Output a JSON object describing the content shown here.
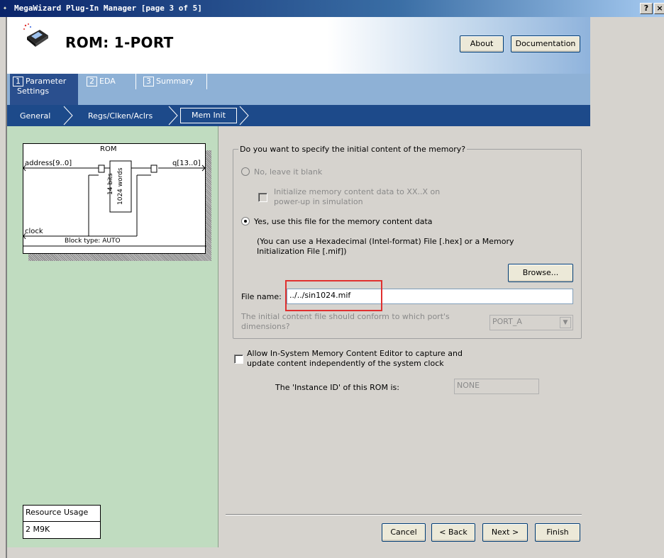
{
  "window": {
    "title": "MegaWizard Plug-In Manager [page 3 of 5]",
    "help_button": "?",
    "close_button": "×"
  },
  "header": {
    "title": "ROM: 1-PORT",
    "about_label": "About",
    "documentation_label": "Documentation"
  },
  "tabs": [
    {
      "num": "1",
      "label": "Parameter Settings",
      "label_line1": "Parameter",
      "label_line2": "Settings",
      "active": true
    },
    {
      "num": "2",
      "label": "EDA",
      "active": false
    },
    {
      "num": "3",
      "label": "Summary",
      "active": false
    }
  ],
  "breadcrumbs": [
    "General",
    "Regs/Clken/Aclrs",
    "Mem Init"
  ],
  "diagram": {
    "title": "ROM",
    "input_address": "address[9..0]",
    "output_q": "q[13..0]",
    "input_clock": "clock",
    "mem_bits": "14 bits",
    "mem_words": "1024 words",
    "block_type": "Block type: AUTO"
  },
  "resource": {
    "header": "Resource Usage",
    "value": "2 M9K"
  },
  "mem_init": {
    "question": "Do you want to specify the initial content of the memory?",
    "option_blank": "No, leave it blank",
    "init_xx_line1": "Initialize memory content data to XX..X on",
    "init_xx_line2": "power-up in simulation",
    "option_file": "Yes, use this file for the memory content data",
    "hint_line1": "(You can use a Hexadecimal (Intel-format) File [.hex] or a Memory",
    "hint_line2": "Initialization File [.mif])",
    "browse_label": "Browse...",
    "file_name_label": "File name:",
    "file_name_value": "../../sin1024.mif",
    "port_question_line1": "The initial content file should conform to which port's",
    "port_question_line2": "dimensions?",
    "port_value": "PORT_A",
    "selected_option": "file"
  },
  "insystem": {
    "label_line1": "Allow In-System Memory Content Editor to capture and",
    "label_line2": "update content independently of the system clock",
    "instance_id_label": "The 'Instance ID' of this ROM is:",
    "instance_id_value": "NONE",
    "checked": false
  },
  "footer": {
    "cancel_label": "Cancel",
    "back_label": "< Back",
    "next_label": "Next >",
    "finish_label": "Finish"
  },
  "colors": {
    "titlebar_dark": "#0a246a",
    "tab_band": "#8eb1d6",
    "crumb_band": "#1d4a8a",
    "left_panel": "#c0dcc0",
    "highlight": "#e0302f"
  }
}
